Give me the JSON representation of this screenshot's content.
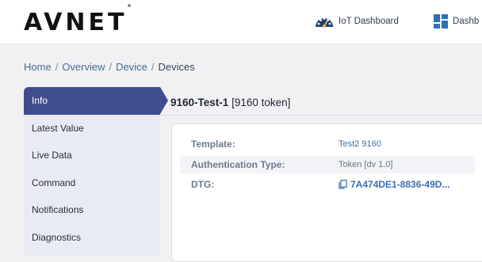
{
  "header": {
    "logo_text": "AVNET",
    "logo_mark": "®",
    "nav": [
      {
        "label": "IoT Dashboard",
        "icon": "speedometer-icon"
      },
      {
        "label": "Dashb",
        "icon": "grid-dashboard-icon"
      }
    ]
  },
  "breadcrumb": {
    "items": [
      "Home",
      "Overview",
      "Device",
      "Devices"
    ],
    "separator": "/"
  },
  "sidebar": {
    "items": [
      {
        "label": "Info",
        "active": true
      },
      {
        "label": "Latest Value"
      },
      {
        "label": "Live Data"
      },
      {
        "label": "Command"
      },
      {
        "label": "Notifications"
      },
      {
        "label": "Diagnostics"
      }
    ]
  },
  "device": {
    "name": "9160-Test-1",
    "token_label": "[9160 token]"
  },
  "details": {
    "template_label": "Template:",
    "template_value": "Test2 9160",
    "auth_label": "Authentication Type:",
    "auth_value": "Token [dv 1.0]",
    "dtg_label": "DTG:",
    "dtg_value": "7A474DE1-8836-49D..."
  },
  "colors": {
    "sidebar_active": "#3f4d8f",
    "link": "#3c6fb3",
    "sidebar_bg": "#e9ebf3"
  }
}
